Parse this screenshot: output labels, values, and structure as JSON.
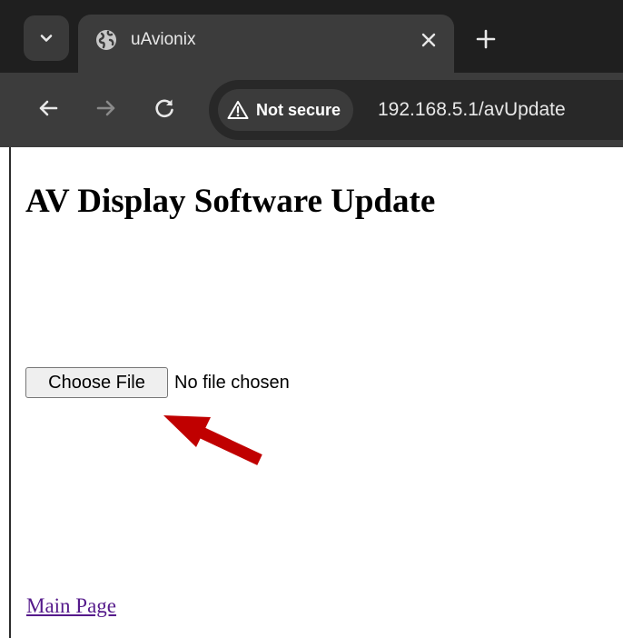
{
  "browser": {
    "tab": {
      "title": "uAvionix",
      "favicon": "globe-icon"
    },
    "security": {
      "label": "Not secure",
      "icon": "warning-triangle-icon"
    },
    "url": "192.168.5.1/avUpdate",
    "colors": {
      "tabstrip": "#1f1f1f",
      "toolbar": "#3c3c3c",
      "omnibox": "#282828"
    }
  },
  "page": {
    "title": "AV Display Software Update",
    "file_input": {
      "button_label": "Choose File",
      "status": "No file chosen"
    },
    "main_link": "Main Page",
    "annotation": {
      "icon": "red-arrow-icon",
      "color": "#c00000"
    }
  }
}
